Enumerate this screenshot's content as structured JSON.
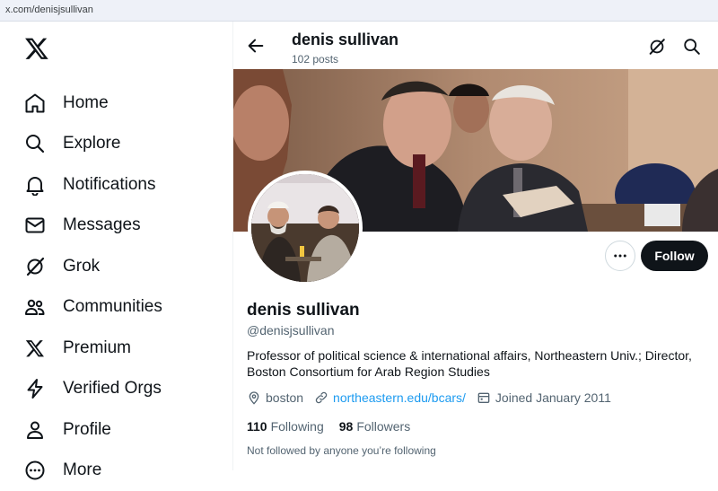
{
  "browser": {
    "url": "x.com/denisjsullivan"
  },
  "sidebar": {
    "logo": "x-logo-icon",
    "items": [
      {
        "label": "Home",
        "icon": "home-icon"
      },
      {
        "label": "Explore",
        "icon": "search-icon"
      },
      {
        "label": "Notifications",
        "icon": "bell-icon"
      },
      {
        "label": "Messages",
        "icon": "envelope-icon"
      },
      {
        "label": "Grok",
        "icon": "grok-icon"
      },
      {
        "label": "Communities",
        "icon": "people-icon"
      },
      {
        "label": "Premium",
        "icon": "x-logo-icon"
      },
      {
        "label": "Verified Orgs",
        "icon": "lightning-icon"
      },
      {
        "label": "Profile",
        "icon": "person-icon"
      },
      {
        "label": "More",
        "icon": "more-circle-icon"
      }
    ]
  },
  "header": {
    "title": "denis sullivan",
    "post_count": "102 posts"
  },
  "profile": {
    "name": "denis sullivan",
    "handle": "@denisjsullivan",
    "bio": "Professor of political science & international affairs, Northeastern Univ.; Director, Boston Consortium for Arab Region Studies",
    "location": "boston",
    "website": "northeastern.edu/bcars/",
    "joined": "Joined January 2011",
    "following_count": "110",
    "following_label": "Following",
    "followers_count": "98",
    "followers_label": "Followers",
    "not_followed_note": "Not followed by anyone you’re following",
    "follow_label": "Follow"
  },
  "colors": {
    "accent": "#1d9bf0",
    "text": "#0f1419",
    "muted": "#536471"
  }
}
